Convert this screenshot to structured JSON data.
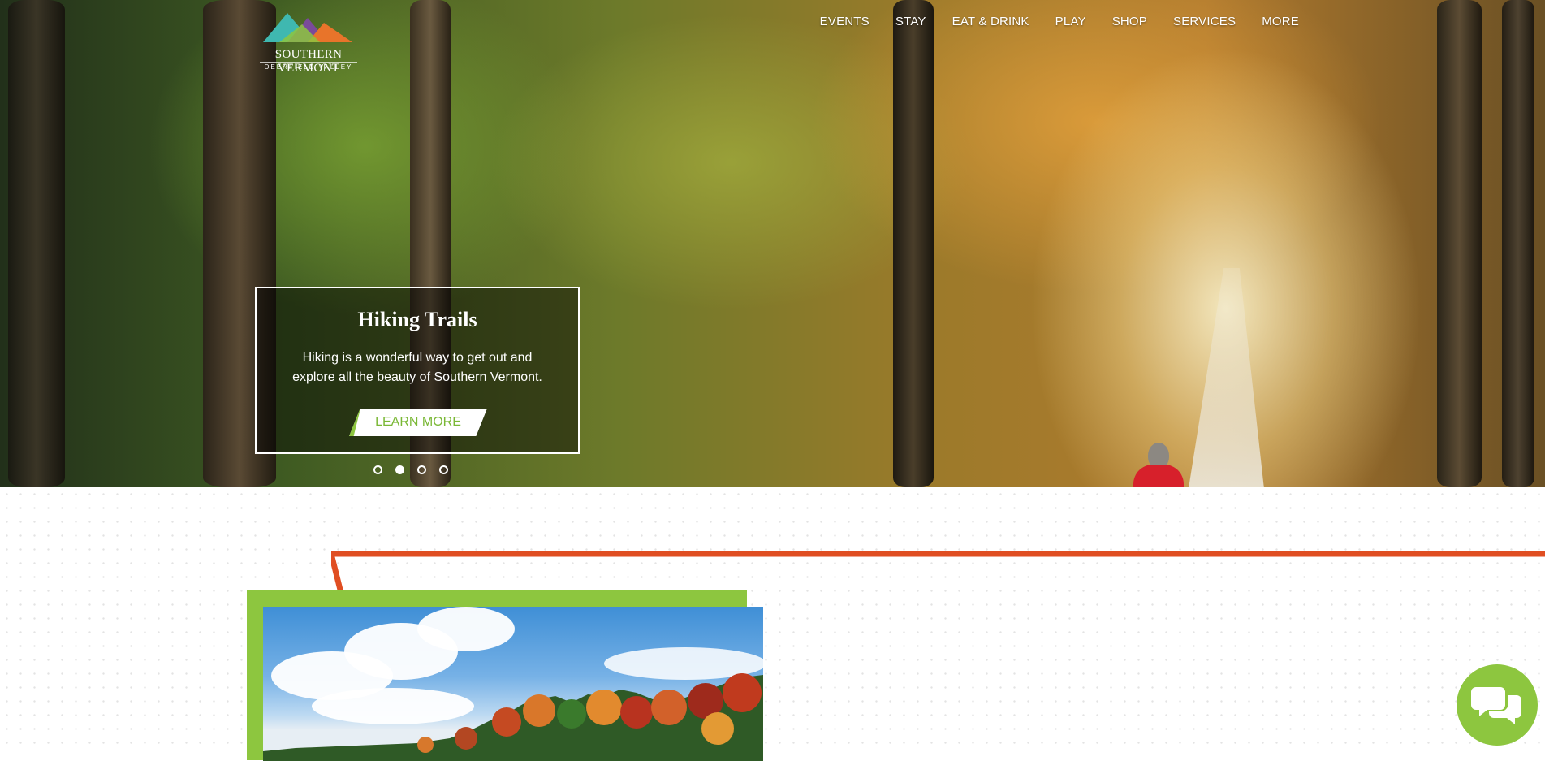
{
  "brand": {
    "name": "SOUTHERN VERMONT",
    "tagline": "DEERFIELD VALLEY",
    "colors": {
      "green": "#8dc63f",
      "orange": "#e04e22",
      "logo_teal": "#3fb8b0",
      "logo_purple": "#7a4a9a",
      "logo_orange": "#e8742a"
    }
  },
  "nav": {
    "items": [
      {
        "label": "EVENTS"
      },
      {
        "label": "STAY"
      },
      {
        "label": "EAT & DRINK"
      },
      {
        "label": "PLAY"
      },
      {
        "label": "SHOP"
      },
      {
        "label": "SERVICES"
      },
      {
        "label": "MORE"
      }
    ]
  },
  "hero": {
    "slide": {
      "title": "Hiking Trails",
      "text": "Hiking is a wonderful way to get out and explore all the beauty of Southern Vermont.",
      "button_label": "LEARN MORE"
    },
    "pager": {
      "count": 4,
      "active_index": 2
    }
  },
  "chat": {
    "icon": "chat-bubbles-icon"
  }
}
